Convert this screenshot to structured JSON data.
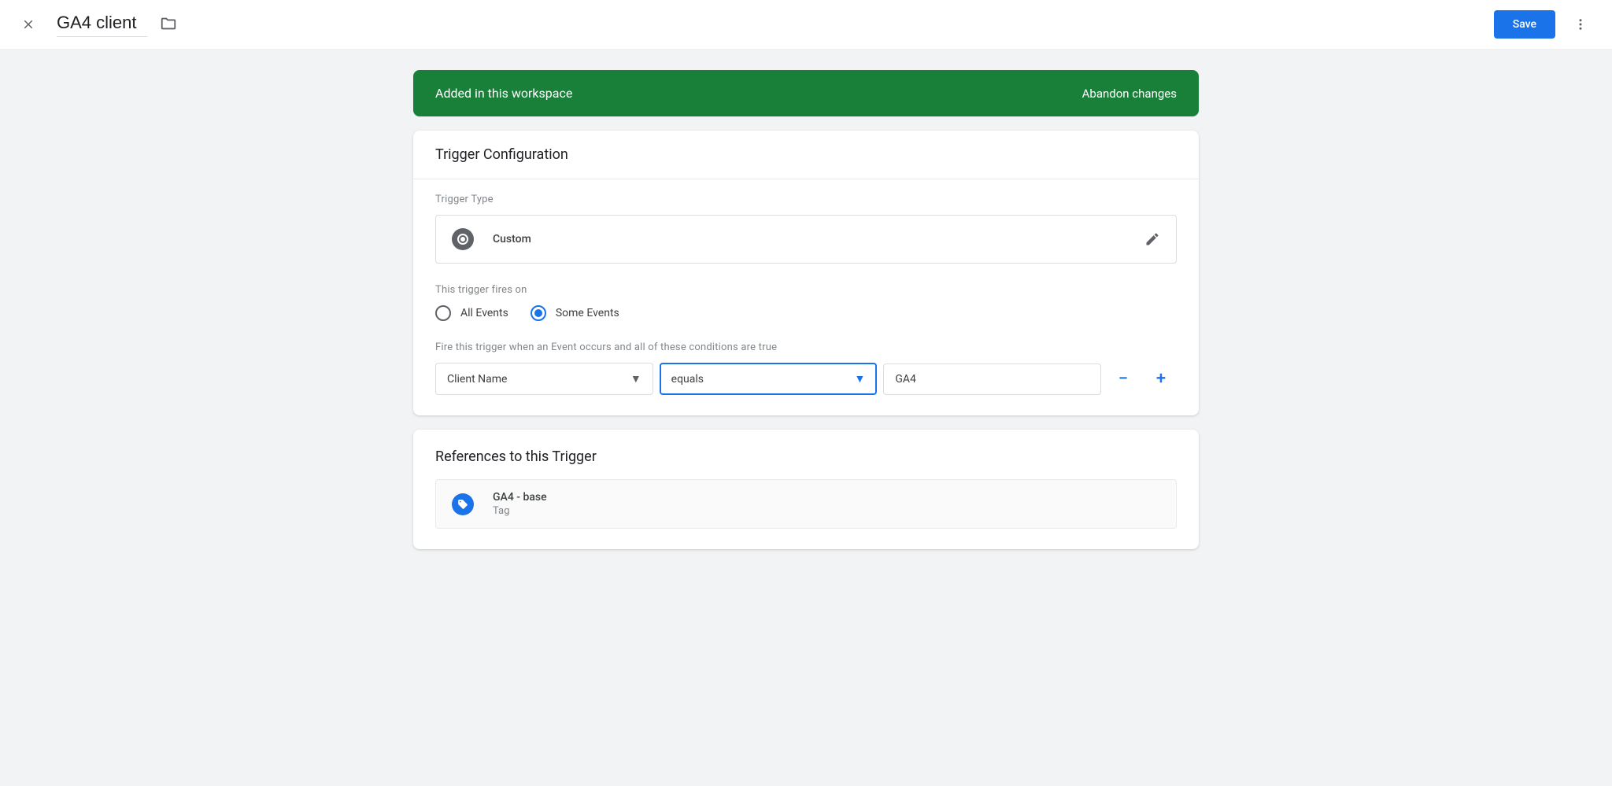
{
  "header": {
    "title": "GA4 client",
    "save_label": "Save"
  },
  "banner": {
    "text": "Added in this workspace",
    "action": "Abandon changes"
  },
  "config": {
    "card_title": "Trigger Configuration",
    "type_label": "Trigger Type",
    "type_value": "Custom",
    "fires_on_label": "This trigger fires on",
    "option_all": "All Events",
    "option_some": "Some Events",
    "condition_label": "Fire this trigger when an Event occurs and all of these conditions are true",
    "condition": {
      "variable": "Client Name",
      "operator": "equals",
      "value": "GA4"
    }
  },
  "references": {
    "card_title": "References to this Trigger",
    "items": [
      {
        "name": "GA4 - base",
        "type": "Tag"
      }
    ]
  }
}
